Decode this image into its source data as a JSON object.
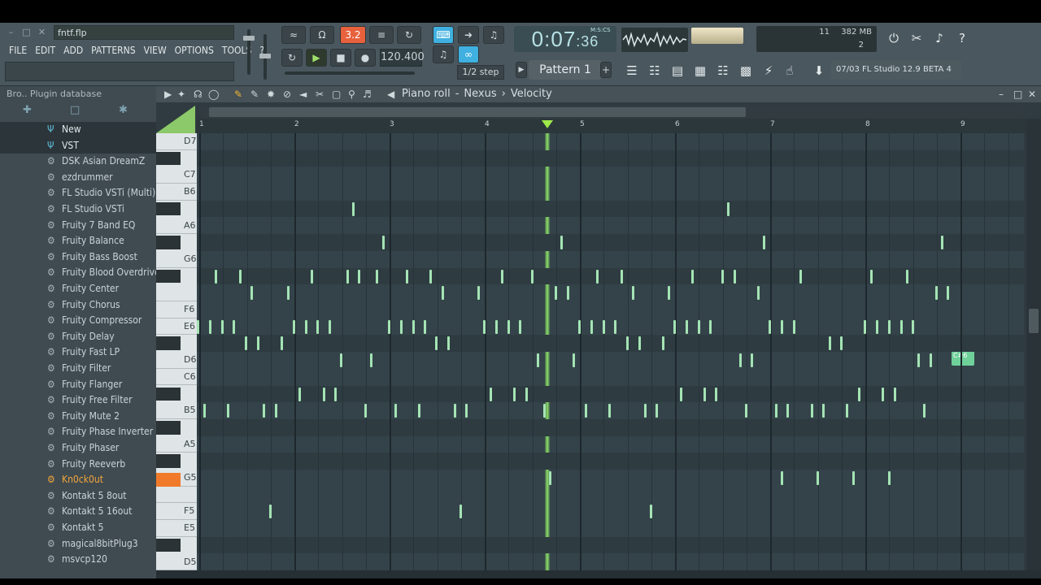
{
  "window": {
    "filename": "fntf.flp"
  },
  "menu": [
    "FILE",
    "EDIT",
    "ADD",
    "PATTERNS",
    "VIEW",
    "OPTIONS",
    "TOOLS",
    "?"
  ],
  "transport": {
    "tempo": "120.400",
    "time_main": "0:07",
    "time_small": ":36",
    "time_label": "M:S:CS",
    "snap": "1/2 step",
    "pattern": "Pattern 1",
    "pattern_label_badge": "3.2"
  },
  "monitor": {
    "voices": "11",
    "memory": "382 MB",
    "cpu_val": "2"
  },
  "hint": {
    "text": "07/03  FL Studio 12.9 BETA 4"
  },
  "browser": {
    "header": "Bro.. Plugin database",
    "items": [
      {
        "label": "New",
        "type": "folder"
      },
      {
        "label": "VST",
        "type": "folder"
      },
      {
        "label": "DSK Asian DreamZ",
        "type": "plugin"
      },
      {
        "label": "ezdrummer",
        "type": "plugin"
      },
      {
        "label": "FL Studio VSTi (Multi)",
        "type": "plugin"
      },
      {
        "label": "FL Studio VSTi",
        "type": "plugin"
      },
      {
        "label": "Fruity 7 Band EQ",
        "type": "plugin"
      },
      {
        "label": "Fruity Balance",
        "type": "plugin"
      },
      {
        "label": "Fruity Bass Boost",
        "type": "plugin"
      },
      {
        "label": "Fruity Blood Overdrive",
        "type": "plugin"
      },
      {
        "label": "Fruity Center",
        "type": "plugin"
      },
      {
        "label": "Fruity Chorus",
        "type": "plugin"
      },
      {
        "label": "Fruity Compressor",
        "type": "plugin"
      },
      {
        "label": "Fruity Delay",
        "type": "plugin"
      },
      {
        "label": "Fruity Fast LP",
        "type": "plugin"
      },
      {
        "label": "Fruity Filter",
        "type": "plugin"
      },
      {
        "label": "Fruity Flanger",
        "type": "plugin"
      },
      {
        "label": "Fruity Free Filter",
        "type": "plugin"
      },
      {
        "label": "Fruity Mute 2",
        "type": "plugin"
      },
      {
        "label": "Fruity Phase Inverter",
        "type": "plugin"
      },
      {
        "label": "Fruity Phaser",
        "type": "plugin"
      },
      {
        "label": "Fruity Reeverb",
        "type": "plugin"
      },
      {
        "label": "Kn0ck0ut",
        "type": "plugin",
        "highlight": true
      },
      {
        "label": "Kontakt 5 8out",
        "type": "plugin"
      },
      {
        "label": "Kontakt 5 16out",
        "type": "plugin"
      },
      {
        "label": "Kontakt 5",
        "type": "plugin"
      },
      {
        "label": "magical8bitPlug3",
        "type": "plugin"
      },
      {
        "label": "msvcp120",
        "type": "plugin"
      }
    ]
  },
  "pianoroll": {
    "title_parts": [
      "Piano roll",
      "-",
      "Nexus",
      "›",
      "Velocity"
    ],
    "bars": [
      "1",
      "2",
      "3",
      "4",
      "5",
      "6",
      "7",
      "8",
      "9"
    ],
    "key_labels": [
      "D7",
      "C7",
      "B6",
      "A6",
      "G6",
      "F6",
      "E6",
      "D6",
      "C6",
      "B5",
      "A5",
      "G5",
      "F5",
      "E5",
      "D5"
    ],
    "note_tooltip": "C#6",
    "playhead_bar": 4.65
  }
}
